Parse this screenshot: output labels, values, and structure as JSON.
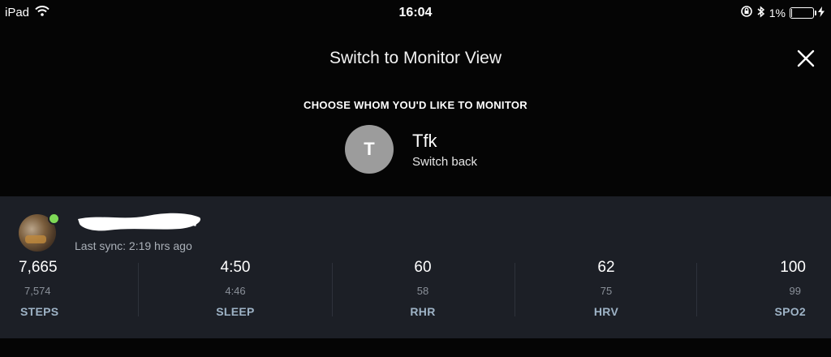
{
  "statusbar": {
    "device": "iPad",
    "time": "16:04",
    "battery_percent": "1%"
  },
  "header": {
    "title": "Switch to Monitor View"
  },
  "subtitle": "CHOOSE WHOM YOU'D LIKE TO MONITOR",
  "account": {
    "initial": "T",
    "name": "Tfk",
    "action": "Switch back"
  },
  "monitored_user": {
    "last_sync": "Last sync: 2:19 hrs ago",
    "status": "online"
  },
  "metrics": [
    {
      "value": "7,665",
      "previous": "7,574",
      "label": "STEPS"
    },
    {
      "value": "4:50",
      "previous": "4:46",
      "label": "SLEEP"
    },
    {
      "value": "60",
      "previous": "58",
      "label": "RHR"
    },
    {
      "value": "62",
      "previous": "75",
      "label": "HRV"
    },
    {
      "value": "100",
      "previous": "99",
      "label": "SPO2"
    }
  ],
  "colors": {
    "background": "#050505",
    "panel": "#1c1f26",
    "metric_label": "#9eb3c6",
    "online": "#7ed957"
  }
}
